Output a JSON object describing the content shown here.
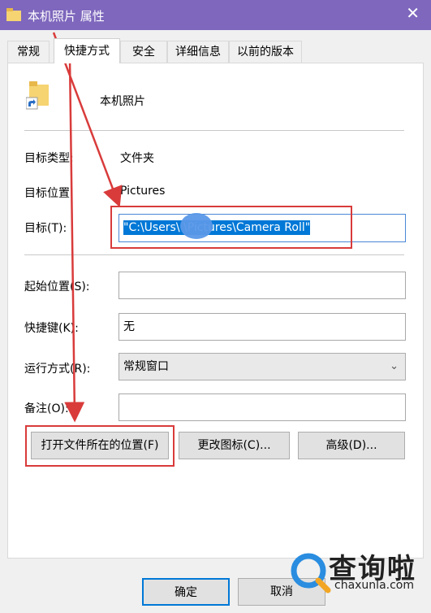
{
  "window": {
    "title": "本机照片 属性",
    "close_label": "✕"
  },
  "tabs": [
    {
      "label": "常规"
    },
    {
      "label": "快捷方式"
    },
    {
      "label": "安全"
    },
    {
      "label": "详细信息"
    },
    {
      "label": "以前的版本"
    }
  ],
  "shortcut": {
    "name": "本机照片",
    "target_type_label": "目标类型:",
    "target_type_value": "文件夹",
    "target_location_label": "目标位置:",
    "target_location_value": "Pictures",
    "target_label": "目标(T):",
    "target_value": "\"C:\\Users\\      \\Pictures\\Camera Roll\"",
    "start_in_label": "起始位置(S):",
    "start_in_value": "",
    "hotkey_label": "快捷键(K):",
    "hotkey_value": "无",
    "run_label": "运行方式(R):",
    "run_value": "常规窗口",
    "comment_label": "备注(O):",
    "comment_value": ""
  },
  "buttons": {
    "open_location": "打开文件所在的位置(F)",
    "change_icon": "更改图标(C)...",
    "advanced": "高级(D)..."
  },
  "footer": {
    "ok": "确定",
    "cancel": "取消"
  },
  "watermark": {
    "brand": "查询啦",
    "site": "chaxunla.com"
  },
  "colors": {
    "titlebar": "#7e67bd",
    "annotation": "#d93b3b",
    "selection": "#0078d7"
  }
}
